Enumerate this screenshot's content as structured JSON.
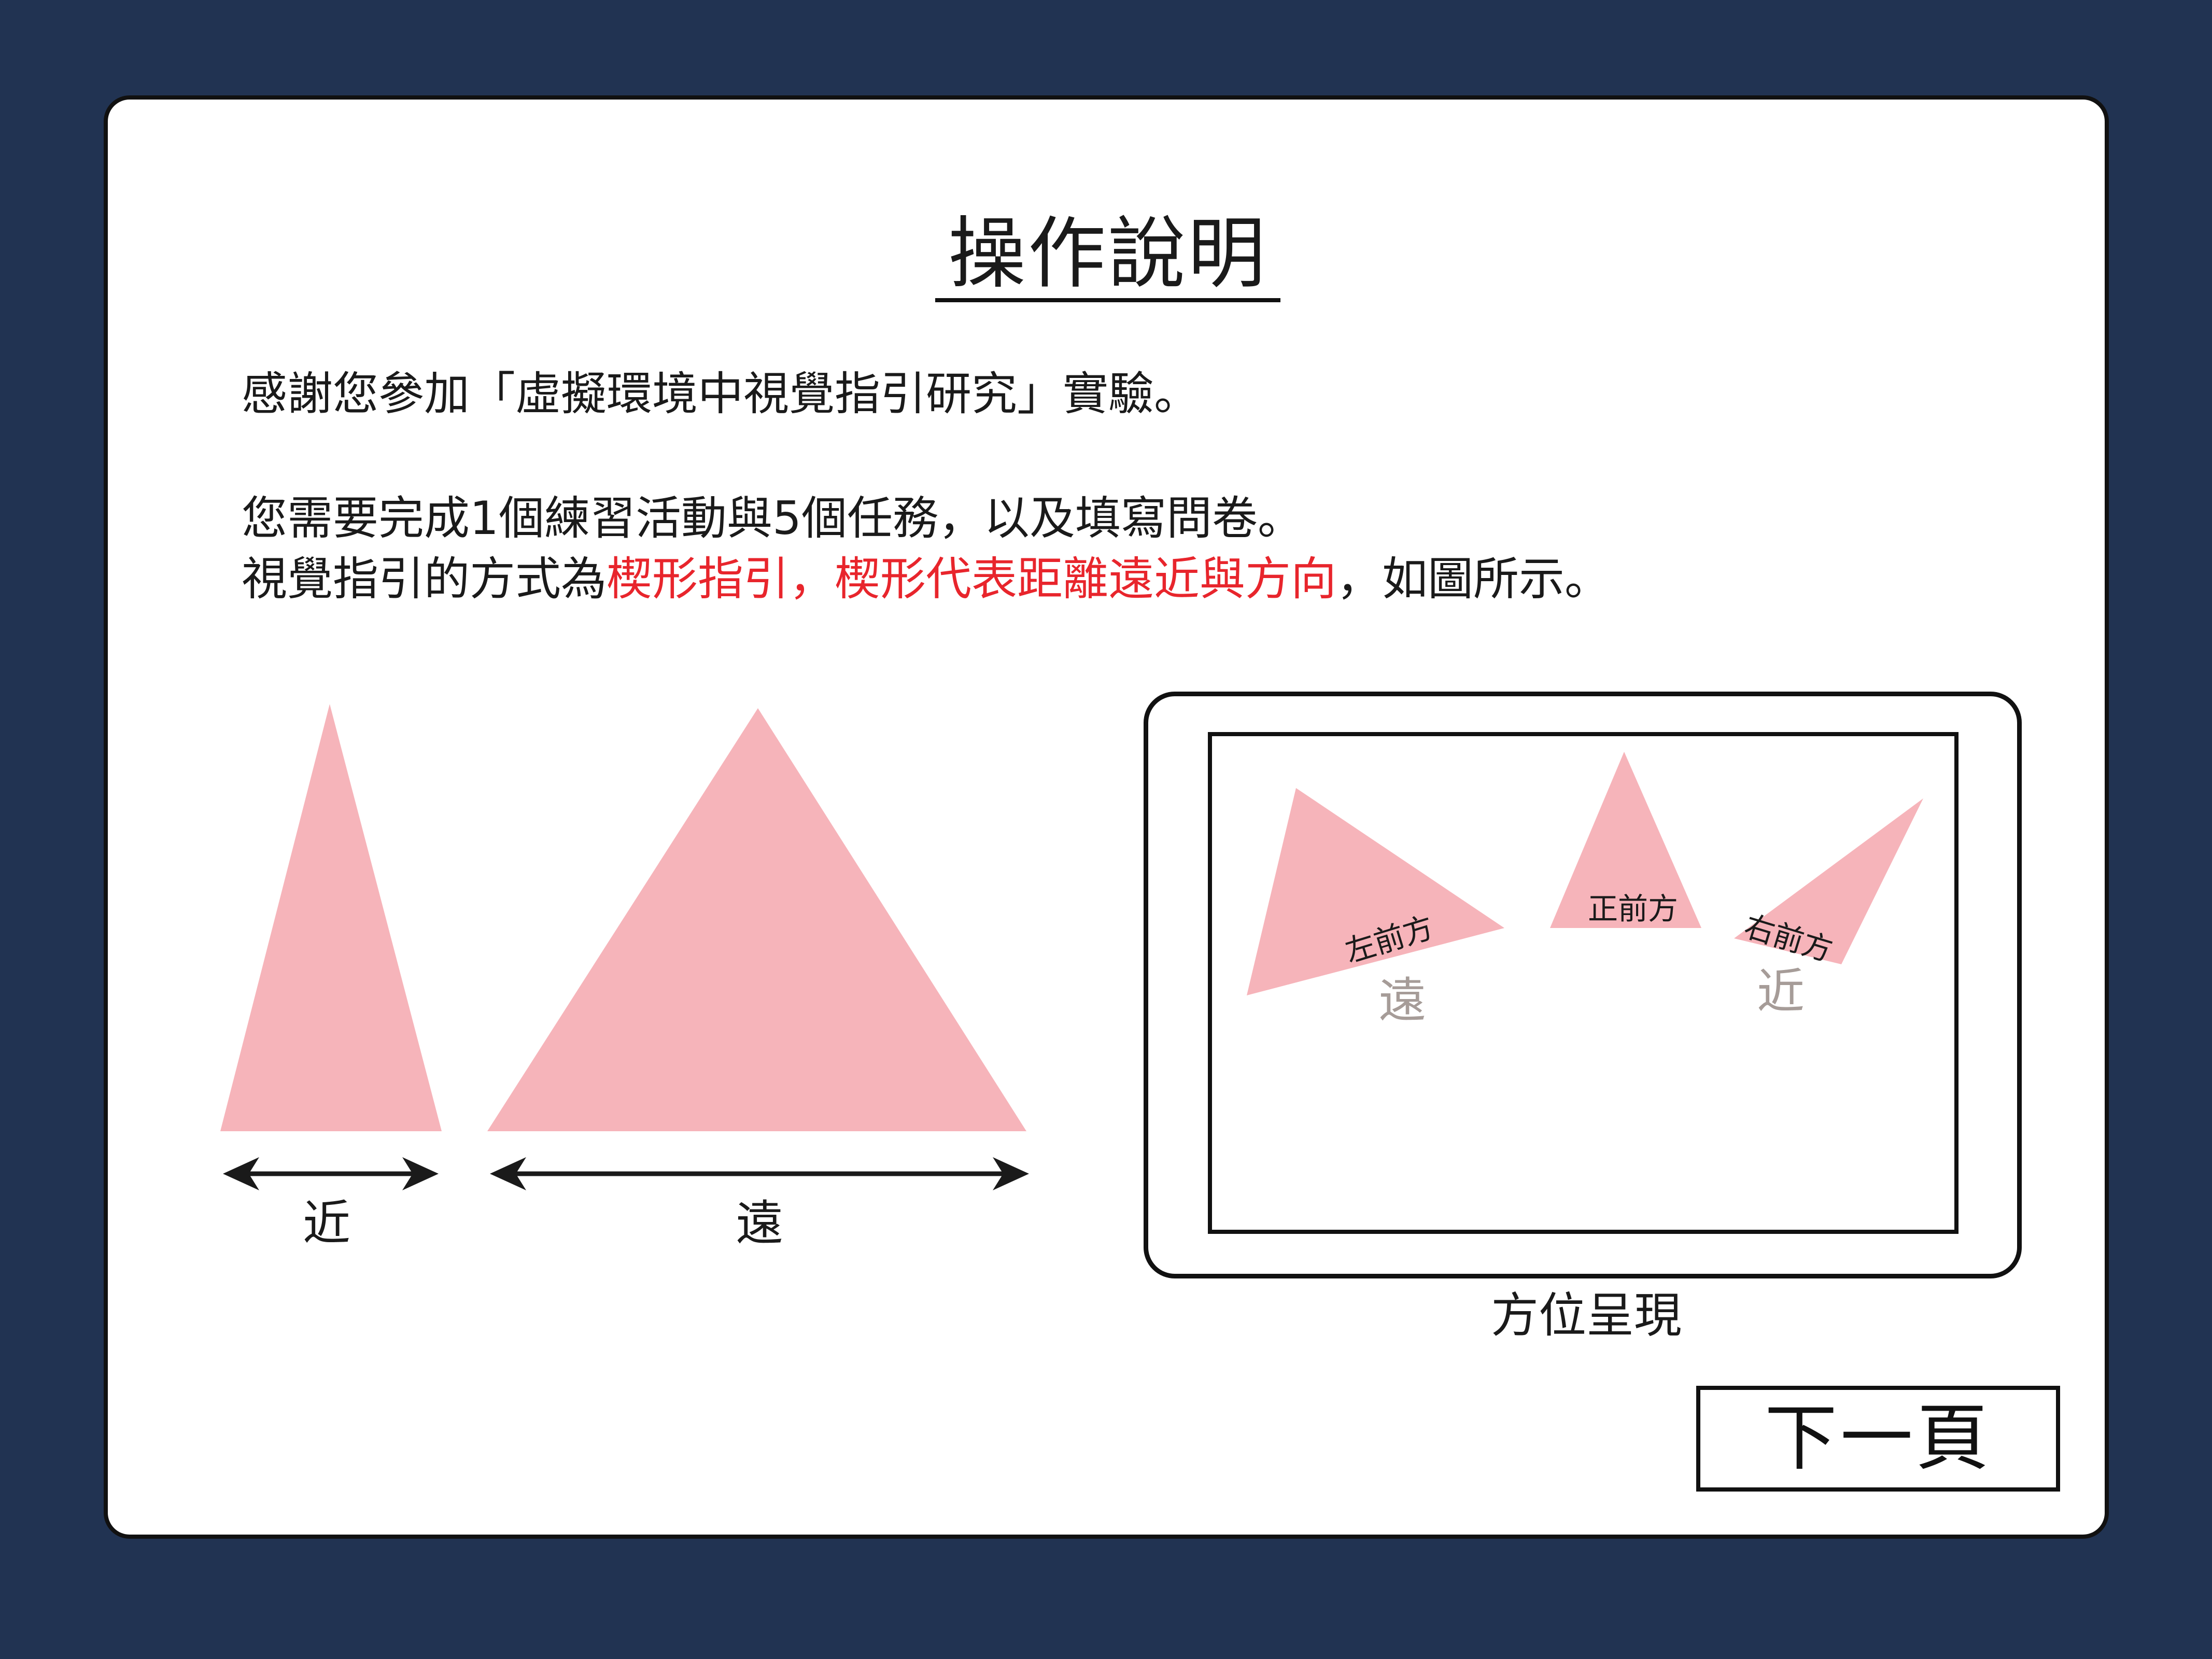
{
  "header": {
    "title": "操作說明"
  },
  "instructions": {
    "intro": "感謝您參加「虛擬環境中視覺指引研究」實驗。",
    "tasks": "您需要完成1個練習活動與5個任務，以及填寫問卷。",
    "guide_prefix": "視覺指引的方式為",
    "guide_highlight": "楔形指引，楔形代表距離遠近與方向",
    "guide_suffix": "，如圖所示。"
  },
  "size_diagram": {
    "near_label": "近",
    "far_label": "遠"
  },
  "direction_diagram": {
    "left_front_label": "左前方",
    "front_label": "正前方",
    "right_front_label": "右前方",
    "far_label": "遠",
    "near_label": "近",
    "caption": "方位呈現"
  },
  "navigation": {
    "next_label": "下一頁"
  },
  "colors": {
    "background": "#213352",
    "wedge": "#f6b4ba",
    "highlight": "#e8252c",
    "distance_text": "#a69c98"
  }
}
